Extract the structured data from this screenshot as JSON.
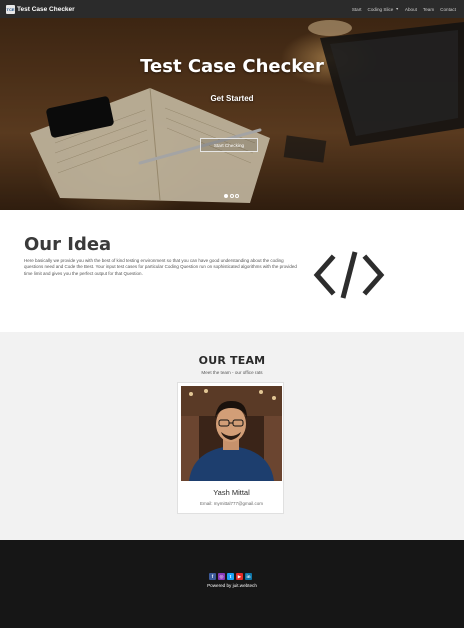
{
  "navbar": {
    "logo_text": "TCE",
    "brand": "Test Case Checker",
    "links": [
      {
        "label": "Start"
      },
      {
        "label": "Coding Slice"
      },
      {
        "label": "About"
      },
      {
        "label": "Team"
      },
      {
        "label": "Contact"
      }
    ]
  },
  "hero": {
    "title": "Test Case Checker",
    "subtitle": "Get Started",
    "button": "Start Checking",
    "slides": 3,
    "active_slide": 1
  },
  "idea": {
    "title": "Our Idea",
    "text": "Here basically we provide you with the best of kind testing environment so that you can have good understanding about the coding questions need and Code the Best. Your input test cases for particular Coding Question run on sophisticated algorithms with the provided time limit and gives you the perfect output for that Question.",
    "icon": "code-icon"
  },
  "team": {
    "title": "OUR TEAM",
    "subtitle": "Meet the team - our office rats",
    "member": {
      "name": "Yash Mittal",
      "email": "Email: mymittal777@gmail.com"
    }
  },
  "footer": {
    "social_icons": [
      "facebook-icon",
      "instagram-icon",
      "twitter-icon",
      "youtube-icon",
      "linkedin-icon"
    ],
    "powered": "Powered by juit.webtech"
  },
  "colors": {
    "navbar": "#2b2b2b",
    "team_bg": "#f2f2f2",
    "footer_bg": "#161616",
    "facebook": "#3b5998",
    "instagram": "#8a3ab9",
    "twitter": "#1da1f2",
    "youtube": "#e52d27",
    "linkedin": "#0e76a8"
  }
}
